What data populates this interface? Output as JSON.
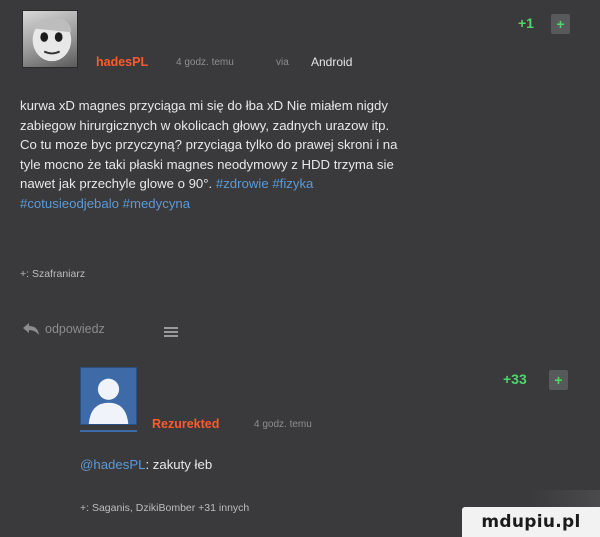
{
  "post1": {
    "author": "hadesPL",
    "time": "4 godz. temu",
    "via": "via",
    "platform": "Android",
    "vote_count": "+1",
    "plus_label": "+",
    "body_lines": [
      "kurwa xD magnes przyciąga mi się do łba xD Nie miałem nigdy",
      "zabiegow hirurgicznych w okolicach głowy, zadnych urazow itp.",
      "Co tu moze byc przyczyną? przyciąga tylko do prawej skroni i na",
      "tyle mocno że taki płaski magnes neodymowy z HDD trzyma sie",
      "nawet jak przechyle glowe o 90°. "
    ],
    "tags": [
      "#zdrowie",
      "#fizyka",
      "#cotusieodjebalo",
      "#medycyna"
    ],
    "voters": "+: Szafraniarz",
    "reply_label": "odpowiedz"
  },
  "post2": {
    "author": "Rezurekted",
    "time": "4 godz. temu",
    "vote_count": "+33",
    "plus_label": "+",
    "mention": "@hadesPL",
    "body_text": ": zakuty łeb",
    "voters": "+: Saganis, DzikiBomber +31 innych"
  },
  "watermark": {
    "text": "mdupiu.pl"
  },
  "colors": {
    "background": "#3a3a3c",
    "author": "#ff5a2c",
    "tag": "#5b9ad6",
    "vote": "#4fd66a"
  },
  "icons": {
    "avatar1": "cartoon-face-avatar",
    "avatar2": "default-user-avatar",
    "reply": "reply-arrow-icon",
    "menu": "hamburger-menu-icon"
  }
}
